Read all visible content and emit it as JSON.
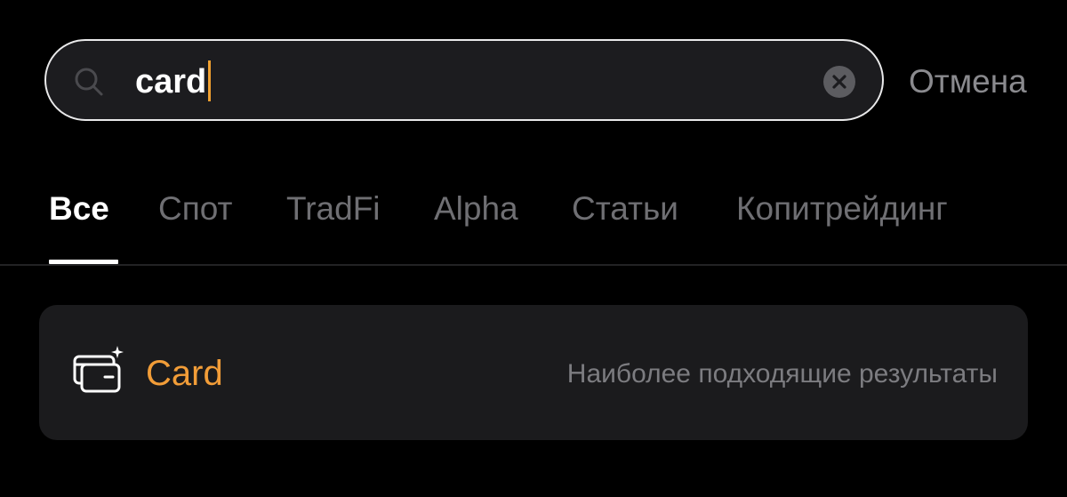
{
  "search": {
    "value": "card",
    "icon": "search-icon",
    "clear_icon": "clear-icon",
    "cancel_label": "Отмена",
    "caret_color": "#f0a030",
    "border_color": "#e9e9ea"
  },
  "tabs": [
    {
      "label": "Все",
      "active": true
    },
    {
      "label": "Спот",
      "active": false
    },
    {
      "label": "TradFi",
      "active": false
    },
    {
      "label": "Alpha",
      "active": false
    },
    {
      "label": "Статьи",
      "active": false
    },
    {
      "label": "Копитрейдинг",
      "active": false
    }
  ],
  "result": {
    "icon": "card-icon",
    "title": "Card",
    "hint": "Наиболее подходящие результаты",
    "title_color": "#f29d38"
  }
}
